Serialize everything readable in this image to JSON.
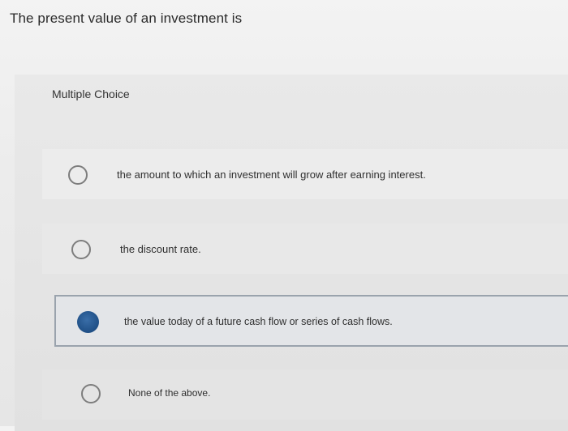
{
  "question": {
    "text": "The present value of an investment is"
  },
  "multiple_choice": {
    "label": "Multiple Choice",
    "options": [
      {
        "text": "the amount to which an investment will grow after earning interest.",
        "selected": false
      },
      {
        "text": "the discount rate.",
        "selected": false
      },
      {
        "text": "the value today of a future cash flow or series of cash flows.",
        "selected": true
      },
      {
        "text": "None of the above.",
        "selected": false
      }
    ]
  },
  "colors": {
    "selected_radio": "#1f4f86",
    "selected_border": "#9aa3ad"
  }
}
